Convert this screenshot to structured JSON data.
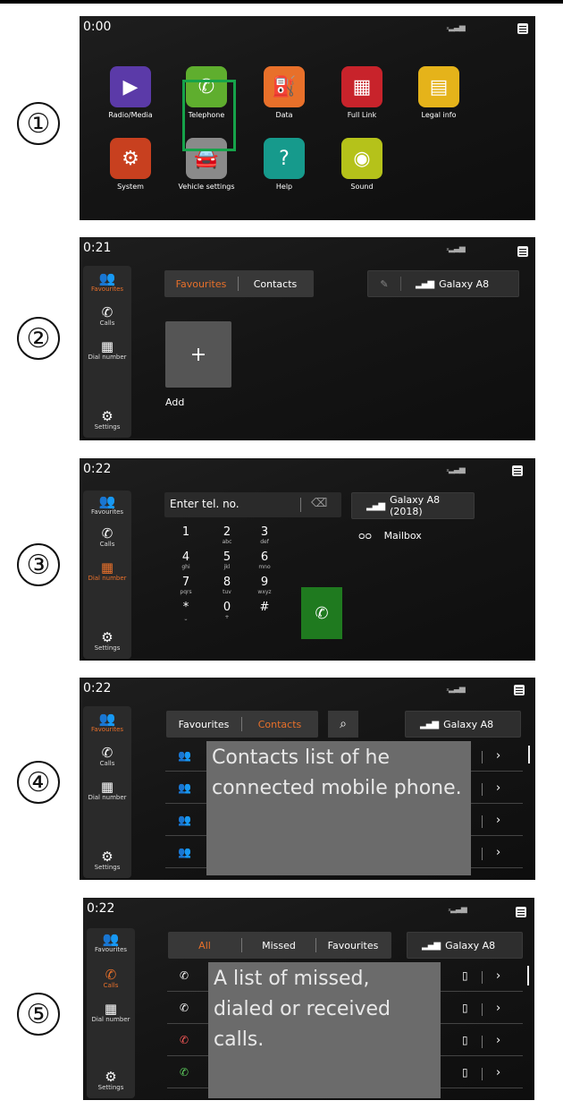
{
  "steps": [
    "①",
    "②",
    "③",
    "④",
    "⑤"
  ],
  "screen1": {
    "clock": "0:00",
    "apps": [
      {
        "label": "Radio/Media",
        "icon": "play-icon",
        "color": "#5b3aa8"
      },
      {
        "label": "Telephone",
        "icon": "phone-icon",
        "color": "#5fae2e"
      },
      {
        "label": "Data",
        "icon": "fuel-icon",
        "color": "#e8702a"
      },
      {
        "label": "Full Link",
        "icon": "full-link-icon",
        "color": "#c8232b"
      },
      {
        "label": "Legal info",
        "icon": "document-icon",
        "color": "#e5b31a"
      },
      {
        "label": "System",
        "icon": "gear-icon",
        "color": "#c8401f"
      },
      {
        "label": "Vehicle settings",
        "icon": "car-icon",
        "color": "#8a8a8a"
      },
      {
        "label": "Help",
        "icon": "help-icon",
        "color": "#169a8c"
      },
      {
        "label": "Sound",
        "icon": "sound-icon",
        "color": "#b5c21a"
      }
    ]
  },
  "side": {
    "favourites": "Favourites",
    "calls": "Calls",
    "dial": "Dial number",
    "settings": "Settings"
  },
  "screen2": {
    "clock": "0:21",
    "tab_favourites": "Favourites",
    "tab_contacts": "Contacts",
    "phone": "Galaxy A8",
    "add_label": "Add",
    "plus": "+"
  },
  "screen3": {
    "clock": "0:22",
    "placeholder": "Enter tel. no.",
    "phone": "Galaxy A8 (2018)",
    "mailbox": "Mailbox",
    "keys": [
      {
        "d": "1",
        "s": ""
      },
      {
        "d": "2",
        "s": "abc"
      },
      {
        "d": "3",
        "s": "def"
      },
      {
        "d": "4",
        "s": "ghi"
      },
      {
        "d": "5",
        "s": "jkl"
      },
      {
        "d": "6",
        "s": "mno"
      },
      {
        "d": "7",
        "s": "pqrs"
      },
      {
        "d": "8",
        "s": "tuv"
      },
      {
        "d": "9",
        "s": "wxyz"
      },
      {
        "d": "*",
        "s": "⎵"
      },
      {
        "d": "0",
        "s": "+"
      },
      {
        "d": "#",
        "s": ""
      }
    ]
  },
  "screen4": {
    "clock": "0:22",
    "tab_favourites": "Favourites",
    "tab_contacts": "Contacts",
    "phone": "Galaxy A8",
    "overlay": "Contacts list of he connected mobile phone."
  },
  "screen5": {
    "clock": "0:22",
    "tab_all": "All",
    "tab_missed": "Missed",
    "tab_favourites": "Favourites",
    "phone": "Galaxy A8",
    "overlay": "A list of missed, dialed or received calls."
  },
  "colors": {
    "accent": "#e8702a",
    "highlight": "#16a34a",
    "call_green": "#1f7a1f"
  }
}
